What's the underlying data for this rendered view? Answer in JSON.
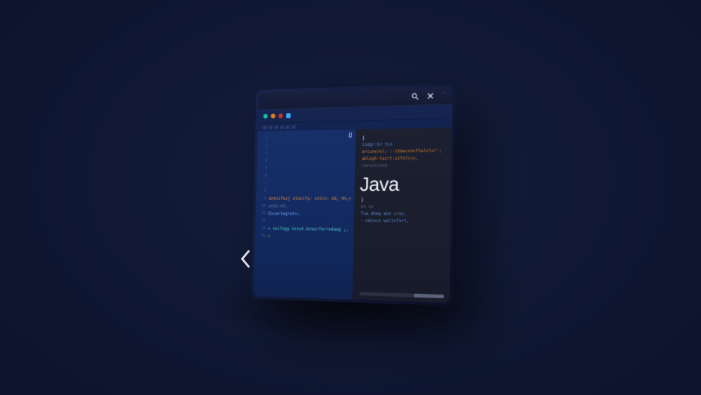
{
  "topbar": {
    "menu_dots": "‥"
  },
  "left_code": {
    "lines": [
      "",
      "",
      "",
      "",
      "",
      "",
      "",
      "",
      "anksifasj stanifq: stoln: 66, 0%;>",
      "ursi-ol;",
      "Escartagrat>;",
      "",
      "> nsifagy Srovt.brearferredseg ;,",
      ">"
    ],
    "gutter_count": 14
  },
  "right_code": {
    "block1": [
      "}",
      "indgr:Sr tin",
      "arcunerol: :-ntmeconsfSalstor';",
      "ablegh-tazrt.sitstscy,",
      "carurcisnd"
    ],
    "label": "Java",
    "block2": [
      "}",
      "on ss",
      "Tna dneg eon crov,",
      "- nmincs watinfort,"
    ]
  },
  "colors": {
    "bg": "#0e1630",
    "panel_left": "#152a60",
    "panel_right": "#1b1f2d",
    "accent_orange": "#d07b35",
    "text_light": "#eef1f6"
  }
}
